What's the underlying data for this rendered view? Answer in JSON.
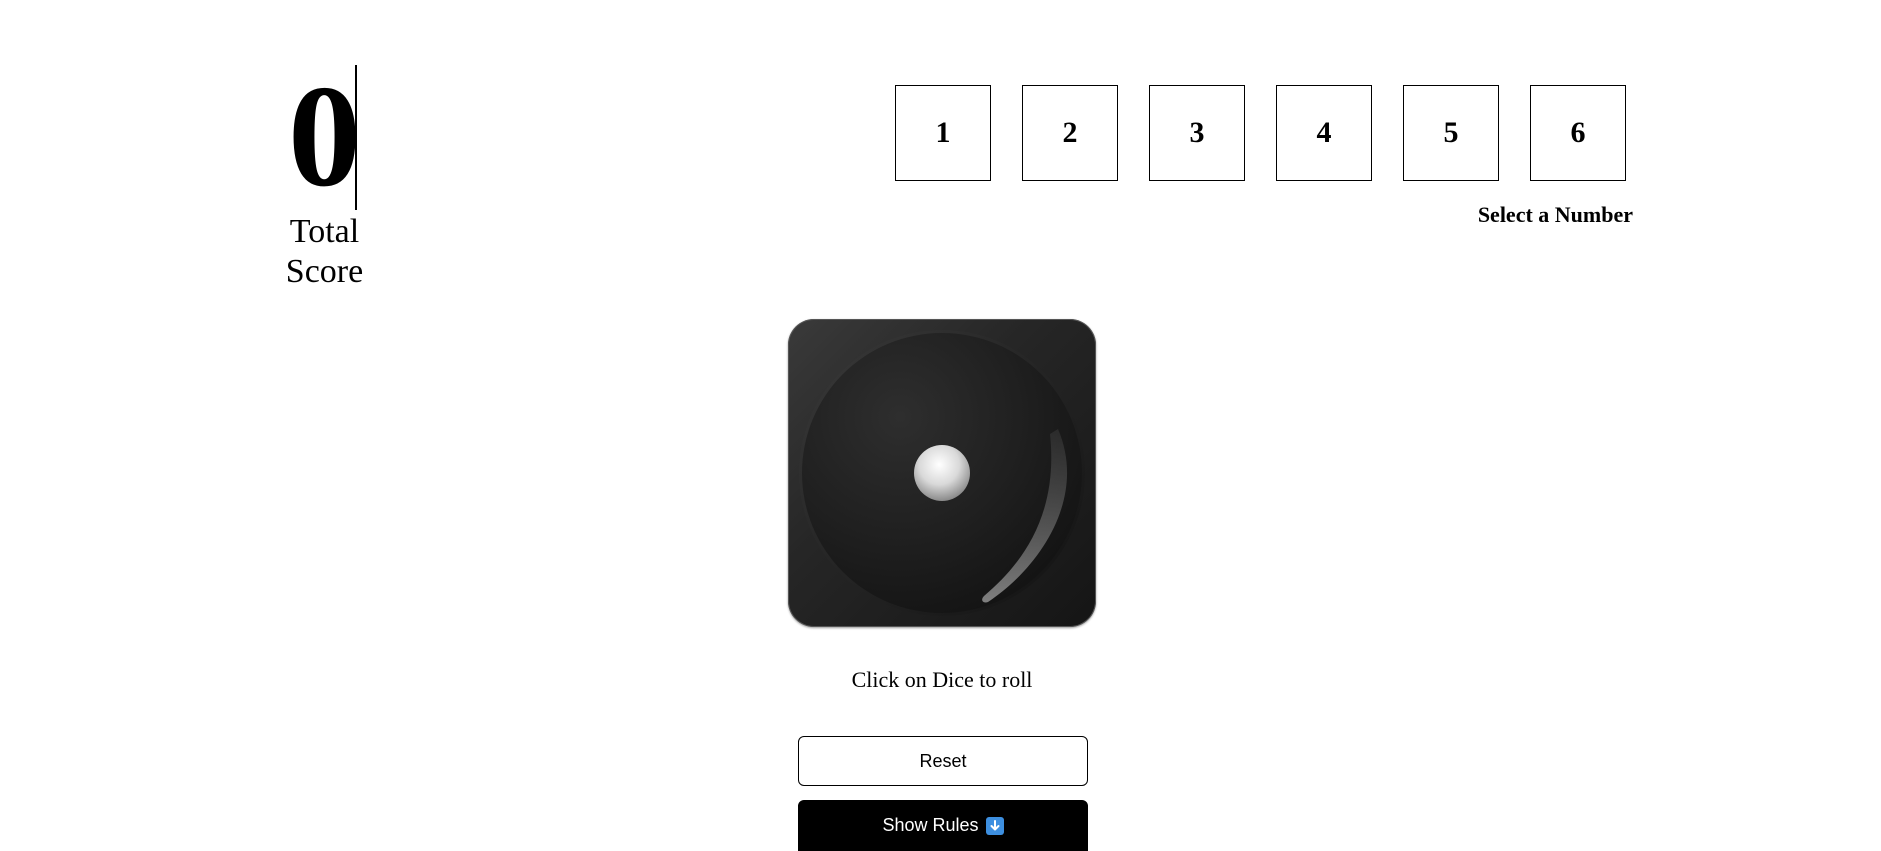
{
  "score": {
    "value": "0",
    "label": "Total Score"
  },
  "number_selector": {
    "numbers": [
      "1",
      "2",
      "3",
      "4",
      "5",
      "6"
    ],
    "label": "Select a Number"
  },
  "dice": {
    "face_value": 1,
    "hint": "Click on Dice to roll"
  },
  "buttons": {
    "reset_label": "Reset",
    "rules_label": "Show Rules",
    "rules_icon": "arrow-down-icon"
  },
  "colors": {
    "dice_face": "#262626",
    "pip": "#e0e0e0",
    "primary_button": "#000000",
    "arrow_icon_bg": "#3d8fe0"
  }
}
